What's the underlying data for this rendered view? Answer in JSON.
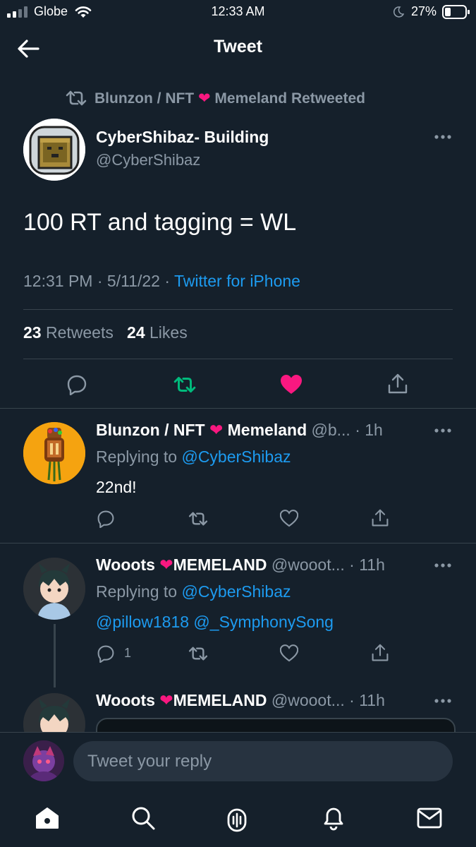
{
  "status_bar": {
    "carrier": "Globe",
    "time": "12:33 AM",
    "battery": "27%"
  },
  "header": {
    "title": "Tweet",
    "back_icon": "arrow-left-icon"
  },
  "retweeted_by": "Blunzon / NFT ❤️ Memeland Retweeted",
  "main_tweet": {
    "author_name": "CyberShibaz- Building",
    "author_handle": "@CyberShibaz",
    "text": "100 RT and tagging = WL",
    "time": "12:31 PM",
    "date": "5/11/22",
    "source": "Twitter for iPhone",
    "retweet_count": "23",
    "retweet_label": "Retweets",
    "like_count": "24",
    "like_label": "Likes",
    "retweeted": true,
    "liked": true
  },
  "replies": [
    {
      "name_a": "Blunzon / NFT",
      "name_b": "Memeland",
      "handle_time": "@b... · 1h",
      "replying_prefix": "Replying to",
      "replying_handle": "@CyberShibaz",
      "text": "22nd!",
      "reply_count": ""
    },
    {
      "name_a": "Wooots",
      "name_b": "MEMELAND",
      "handle_time": "@wooot... · 11h",
      "replying_prefix": "Replying to",
      "replying_handle": "@CyberShibaz",
      "mentions": "@pillow1818 @_SymphonySong",
      "reply_count": "1"
    },
    {
      "name_a": "Wooots",
      "name_b": "MEMELAND",
      "handle_time": "@wooot... · 11h"
    }
  ],
  "compose": {
    "placeholder": "Tweet your reply"
  },
  "tab_bar": [
    "home-icon",
    "search-icon",
    "spaces-icon",
    "notifications-icon",
    "messages-icon"
  ],
  "colors": {
    "background": "#15202b",
    "accent": "#1d9bf0",
    "retweet_green": "#00ba7c",
    "like_pink": "#f91880",
    "muted_text": "#8b98a5"
  }
}
